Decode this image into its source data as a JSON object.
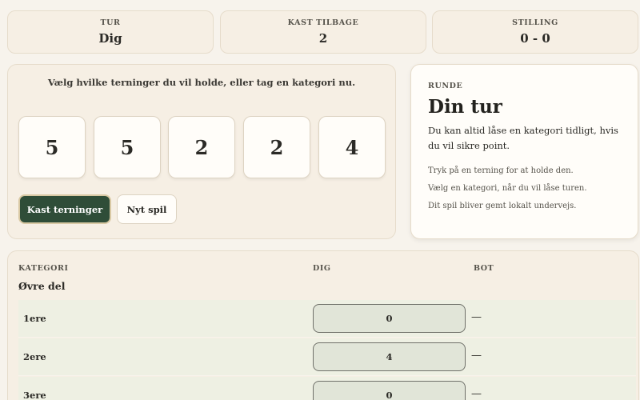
{
  "stats": {
    "turn": {
      "label": "TUR",
      "value": "Dig"
    },
    "rolls_left": {
      "label": "KAST TILBAGE",
      "value": "2"
    },
    "score": {
      "label": "STILLING",
      "value": "0 - 0"
    }
  },
  "dice_panel": {
    "prompt": "Vælg hvilke terninger du vil holde, eller tag en kategori nu.",
    "dice": [
      "5",
      "5",
      "2",
      "2",
      "4"
    ],
    "roll_button": "Kast terninger",
    "new_game_button": "Nyt spil"
  },
  "info": {
    "kicker": "RUNDE",
    "title": "Din tur",
    "lead": "Du kan altid låse en kategori tidligt, hvis du vil sikre point.",
    "hints": [
      "Tryk på en terning for at holde den.",
      "Vælg en kategori, når du vil låse turen.",
      "Dit spil bliver gemt lokalt undervejs."
    ]
  },
  "scorecard": {
    "headers": {
      "category": "KATEGORI",
      "you": "DIG",
      "bot": "BOT"
    },
    "section": "Øvre del",
    "rows": [
      {
        "name": "1ere",
        "you": "0",
        "bot": "—"
      },
      {
        "name": "2ere",
        "you": "4",
        "bot": "—"
      },
      {
        "name": "3ere",
        "you": "0",
        "bot": "—"
      }
    ]
  }
}
